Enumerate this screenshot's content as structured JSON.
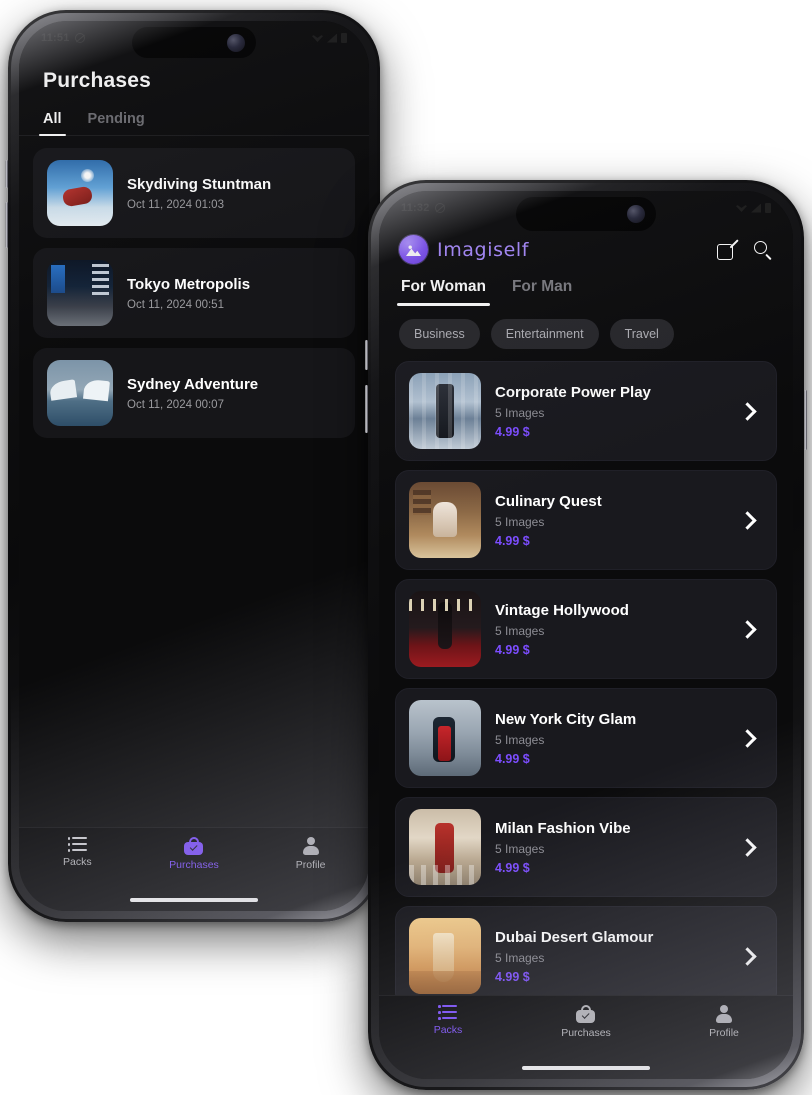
{
  "colors": {
    "accent": "#7c4dff",
    "brand_text": "#a98bff",
    "screen_bg": "#0b0b0c",
    "card_bg": "#19191e",
    "chip_bg": "#27272b",
    "muted_text": "#8d8d94",
    "price_text": "#7c4dff"
  },
  "back_phone": {
    "status_bar": {
      "time": "11:51",
      "dnd_icon": "do-not-disturb-icon",
      "wifi_icon": "wifi-icon",
      "signal_icon": "signal-icon",
      "battery_icon": "battery-icon"
    },
    "page_title": "Purchases",
    "tabs": [
      {
        "label": "All",
        "active": true
      },
      {
        "label": "Pending",
        "active": false
      }
    ],
    "purchases": [
      {
        "title": "Skydiving Stuntman",
        "date": "Oct 11, 2024 01:03",
        "art": "a-sky"
      },
      {
        "title": "Tokyo Metropolis",
        "date": "Oct 11, 2024 00:51",
        "art": "a-tokyo"
      },
      {
        "title": "Sydney Adventure",
        "date": "Oct 11, 2024 00:07",
        "art": "a-sydney"
      }
    ],
    "bottom_nav": [
      {
        "label": "Packs",
        "icon": "list-icon",
        "active": false
      },
      {
        "label": "Purchases",
        "icon": "shopping-bag-check-icon",
        "active": true
      },
      {
        "label": "Profile",
        "icon": "person-icon",
        "active": false
      }
    ]
  },
  "front_phone": {
    "status_bar": {
      "time": "11:32",
      "dnd_icon": "do-not-disturb-icon",
      "wifi_icon": "wifi-icon",
      "signal_icon": "signal-icon",
      "battery_icon": "battery-icon"
    },
    "brand": {
      "name": "Imagiself",
      "logo_icon": "image-mountain-icon"
    },
    "actions": [
      {
        "icon": "compose-edit-icon"
      },
      {
        "icon": "search-icon"
      }
    ],
    "tabs": [
      {
        "label": "For Woman",
        "active": true
      },
      {
        "label": "For Man",
        "active": false
      }
    ],
    "chips": [
      {
        "label": "Business"
      },
      {
        "label": "Entertainment"
      },
      {
        "label": "Travel"
      }
    ],
    "packs": [
      {
        "title": "Corporate Power Play",
        "images": "5 Images",
        "price": "4.99 $",
        "art": "a-corp"
      },
      {
        "title": "Culinary Quest",
        "images": "5 Images",
        "price": "4.99 $",
        "art": "a-culi"
      },
      {
        "title": "Vintage Hollywood",
        "images": "5 Images",
        "price": "4.99 $",
        "art": "a-holly"
      },
      {
        "title": "New York City Glam",
        "images": "5 Images",
        "price": "4.99 $",
        "art": "a-nyc"
      },
      {
        "title": "Milan Fashion Vibe",
        "images": "5 Images",
        "price": "4.99 $",
        "art": "a-milan"
      },
      {
        "title": "Dubai Desert Glamour",
        "images": "5 Images",
        "price": "4.99 $",
        "art": "a-dubai"
      }
    ],
    "bottom_nav": [
      {
        "label": "Packs",
        "icon": "list-icon",
        "active": true
      },
      {
        "label": "Purchases",
        "icon": "shopping-bag-check-icon",
        "active": false
      },
      {
        "label": "Profile",
        "icon": "person-icon",
        "active": false
      }
    ]
  }
}
